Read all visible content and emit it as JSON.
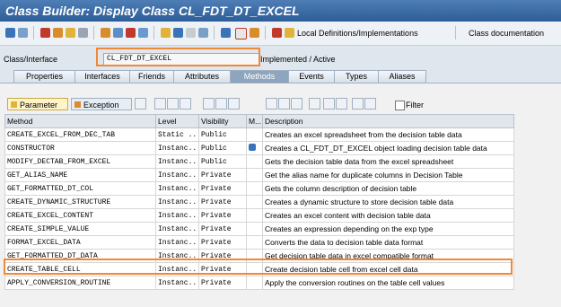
{
  "title": "Class Builder: Display Class CL_FDT_DT_EXCEL",
  "toolbar": {
    "local_defs": "Local Definitions/Implementations",
    "class_doc": "Class documentation"
  },
  "class_interface": {
    "label": "Class/Interface",
    "value": "CL_FDT_DT_EXCEL",
    "status": "Implemented / Active"
  },
  "tabs": [
    "Properties",
    "Interfaces",
    "Friends",
    "Attributes",
    "Methods",
    "Events",
    "Types",
    "Aliases"
  ],
  "active_tab": "Methods",
  "panel": {
    "parameter": "Parameter",
    "exception": "Exception",
    "filter": "Filter"
  },
  "table": {
    "headers": [
      "Method",
      "Level",
      "Visibility",
      "M...",
      "Description"
    ],
    "rows": [
      [
        "CREATE_EXCEL_FROM_DEC_TAB",
        "Static ..",
        "Public",
        "",
        "Creates an excel spreadsheet from the decision table data"
      ],
      [
        "CONSTRUCTOR",
        "Instanc..",
        "Public",
        "icon",
        "Creates a CL_FDT_DT_EXCEL object loading decision table data"
      ],
      [
        "MODIFY_DECTAB_FROM_EXCEL",
        "Instanc..",
        "Public",
        "",
        "Gets the decision table data from the excel spreadsheet"
      ],
      [
        "GET_ALIAS_NAME",
        "Instanc..",
        "Private",
        "",
        "Get the alias name for duplicate columns in Decision Table"
      ],
      [
        "GET_FORMATTED_DT_COL",
        "Instanc..",
        "Private",
        "",
        "Gets the column description of decision table"
      ],
      [
        "CREATE_DYNAMIC_STRUCTURE",
        "Instanc..",
        "Private",
        "",
        "Creates a dynamic structure to store decision table data"
      ],
      [
        "CREATE_EXCEL_CONTENT",
        "Instanc..",
        "Private",
        "",
        "Creates an excel content with decision table data"
      ],
      [
        "CREATE_SIMPLE_VALUE",
        "Instanc..",
        "Private",
        "",
        "Creates an expression depending on the exp type"
      ],
      [
        "FORMAT_EXCEL_DATA",
        "Instanc..",
        "Private",
        "",
        "Converts the data to decision table data format"
      ],
      [
        "GET_FORMATTED_DT_DATA",
        "Instanc..",
        "Private",
        "",
        "Get decision table data in excel compatible format"
      ],
      [
        "CREATE_TABLE_CELL",
        "Instanc..",
        "Private",
        "",
        "Create decision table cell from excel cell data"
      ],
      [
        "APPLY_CONVERSION_ROUTINE",
        "Instanc..",
        "Private",
        "",
        "Apply the conversion routines on the table cell values"
      ]
    ]
  }
}
